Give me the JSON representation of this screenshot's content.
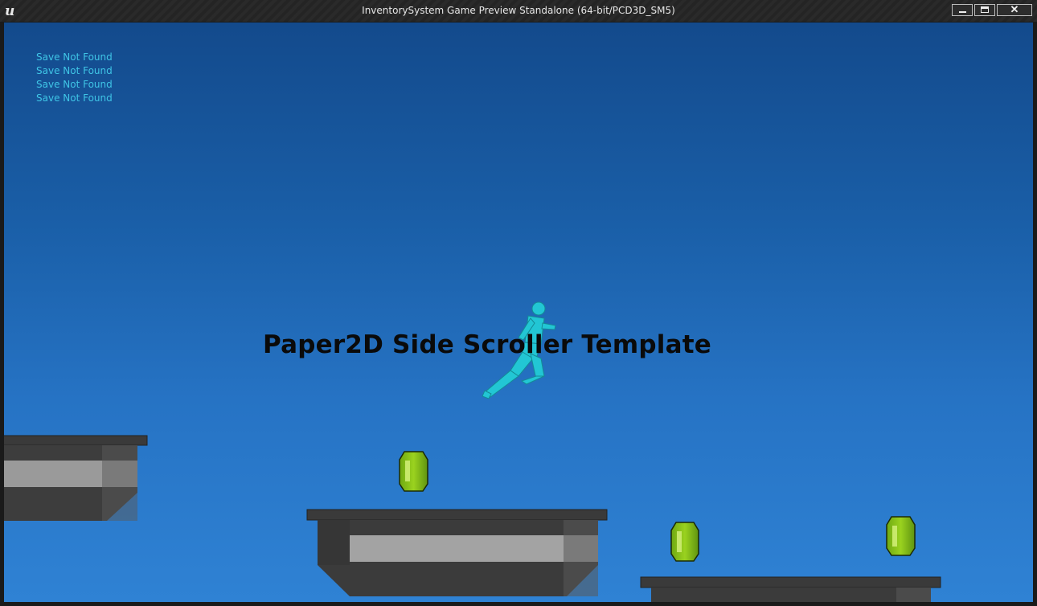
{
  "window": {
    "title": "InventorySystem Game Preview Standalone (64-bit/PCD3D_SM5)",
    "logo_icon": "unreal-engine-logo",
    "controls": [
      "minimize",
      "maximize",
      "close"
    ]
  },
  "debug_messages": [
    "Save Not Found",
    "Save Not Found",
    "Save Not Found",
    "Save Not Found"
  ],
  "game": {
    "title": "Paper2D Side Scroller Template",
    "sky_color_top": "#134a8c",
    "sky_color_bottom": "#2f82d4",
    "debug_text_color": "#3fc5e6",
    "character_color": "#20c9d6",
    "gem_color": "#8cc21a",
    "platform_color": "#4a4a4a",
    "gem_count": 3,
    "platform_count": 3
  }
}
